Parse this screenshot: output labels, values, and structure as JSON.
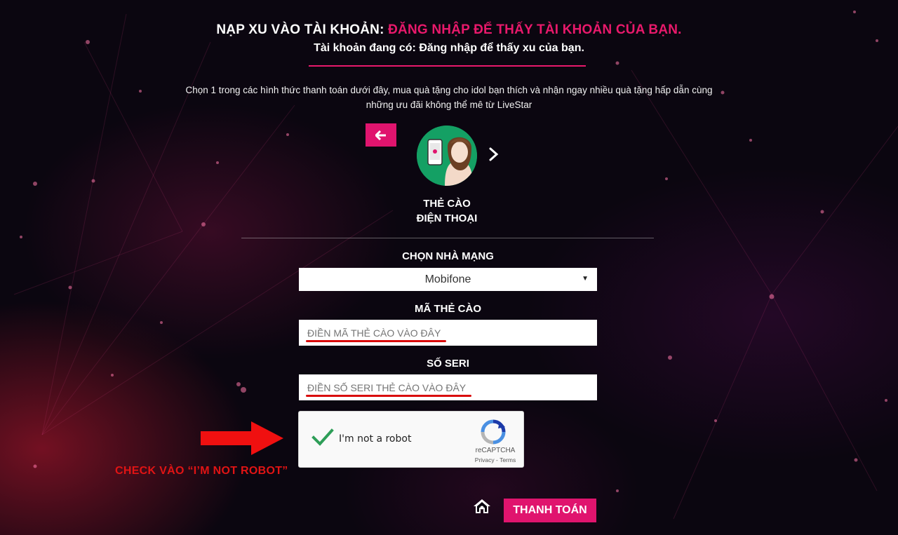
{
  "header": {
    "title_prefix": "NẠP XU VÀO TÀI KHOẢN:",
    "title_highlight": "ĐĂNG NHẬP ĐỂ THẤY TÀI KHOẢN CỦA BẠN.",
    "subtitle": "Tài khoản đang có: Đăng nhập để thấy xu của bạn."
  },
  "intro_text": "Chọn 1 trong các hình thức thanh toán dưới đây, mua quà tặng cho idol bạn thích và nhận ngay nhiều quà tặng hấp dẫn cùng những ưu đãi không thể mê từ LiveStar",
  "payment_method": {
    "line1": "THẺ CÀO",
    "line2": "ĐIỆN THOẠI",
    "back_icon": "arrow-left-icon",
    "next_icon": "chevron-right-icon"
  },
  "form": {
    "carrier_label": "CHỌN NHÀ MẠNG",
    "carrier_value": "Mobifone",
    "card_code_label": "MÃ THẺ CÀO",
    "card_code_placeholder": "ĐIỀN MÃ THẺ CÀO VÀO ĐÂY",
    "serial_label": "SỐ SERI",
    "serial_placeholder": "ĐIỀN SỐ SERI THẺ CÀO VÀO ĐÂY"
  },
  "captcha": {
    "label": "I'm not a robot",
    "brand": "reCAPTCHA",
    "terms": "Privacy - Terms",
    "checked": true
  },
  "annotation": "CHECK VÀO  “I’M NOT ROBOT”",
  "pay_button": "THANH TOÁN",
  "colors": {
    "accent": "#e0146e",
    "annotation_red": "#e11414",
    "avatar_bg": "#14a064"
  }
}
